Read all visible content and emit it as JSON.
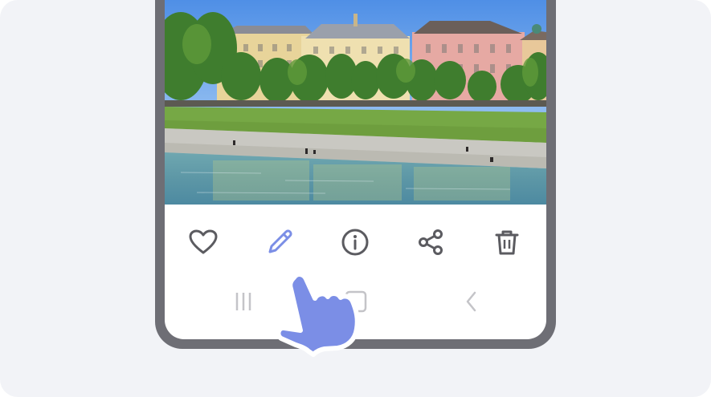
{
  "photo": {
    "subject": "riverside-buildings-photo"
  },
  "action_bar": {
    "items": [
      {
        "icon": "heart-icon",
        "label": "Favorite"
      },
      {
        "icon": "pencil-icon",
        "label": "Edit",
        "highlighted": true
      },
      {
        "icon": "info-icon",
        "label": "Details"
      },
      {
        "icon": "share-icon",
        "label": "Share"
      },
      {
        "icon": "trash-icon",
        "label": "Delete"
      }
    ]
  },
  "nav_bar": {
    "items": [
      {
        "icon": "recents-icon",
        "label": "Recent apps"
      },
      {
        "icon": "home-icon",
        "label": "Home"
      },
      {
        "icon": "back-icon",
        "label": "Back"
      }
    ]
  },
  "colors": {
    "background": "#f2f3f7",
    "phone_frame": "#6e6e75",
    "icon_default": "#5b5b60",
    "icon_highlight": "#7b8ee6",
    "hand": "#7b8ee6",
    "nav_icon": "#c4c4c8"
  }
}
